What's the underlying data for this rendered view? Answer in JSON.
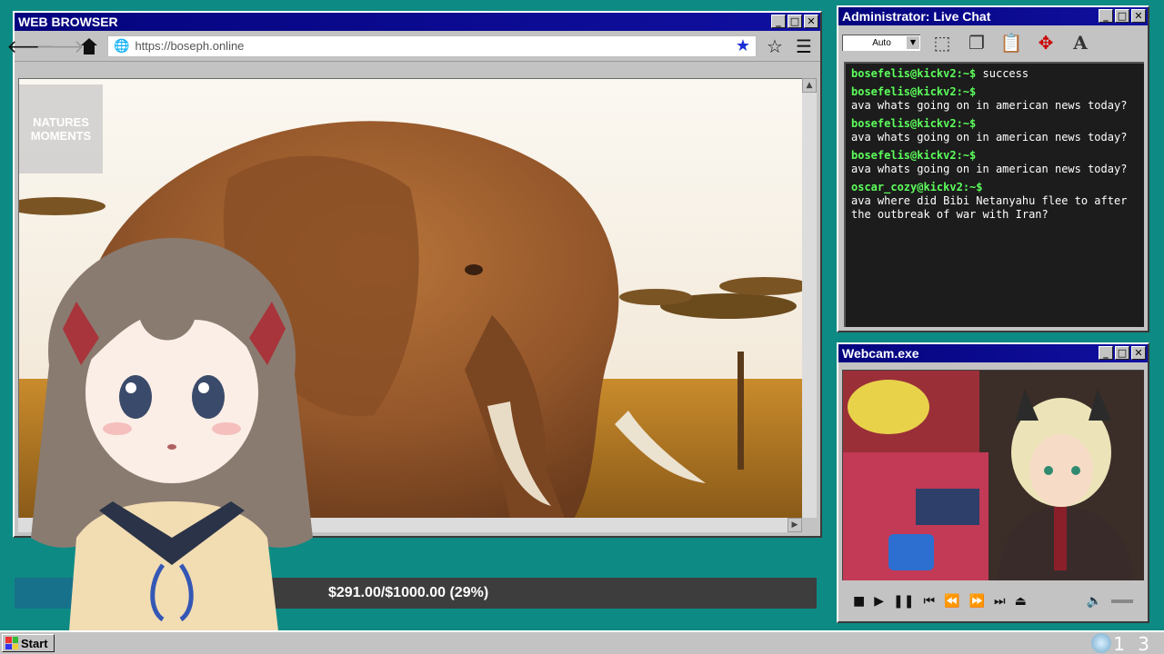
{
  "browser": {
    "title": "WEB BROWSER",
    "url": "https://boseph.online",
    "page_logo": "NATURES MOMENTS"
  },
  "chat": {
    "title": "Administrator: Live Chat",
    "font_select": "Auto",
    "messages": [
      {
        "user": "bosefelis@kickv2:~$",
        "text": "success"
      },
      {
        "user": "bosefelis@kickv2:~$",
        "text": "ava whats going on in american news today?"
      },
      {
        "user": "bosefelis@kickv2:~$",
        "text": "ava whats going on in american news today?"
      },
      {
        "user": "bosefelis@kickv2:~$",
        "text": "ava whats going on in american news today?"
      },
      {
        "user": "oscar_cozy@kickv2:~$",
        "text": "ava where did Bibi Netanyahu flee to after the outbreak of war with Iran?"
      }
    ]
  },
  "webcam": {
    "title": "Webcam.exe"
  },
  "goal": {
    "text": "$291.00/$1000.00 (29%)",
    "progress": 0.29
  },
  "taskbar": {
    "start_label": "Start",
    "clock": "1 3"
  },
  "window_controls": {
    "minimize": "_",
    "maximize": "□",
    "close": "✕"
  },
  "colors": {
    "desktop": "#0e8a84",
    "titlebar": "#05047e",
    "chat_user": "#5cff5c",
    "goal_fill": "#17718a"
  }
}
